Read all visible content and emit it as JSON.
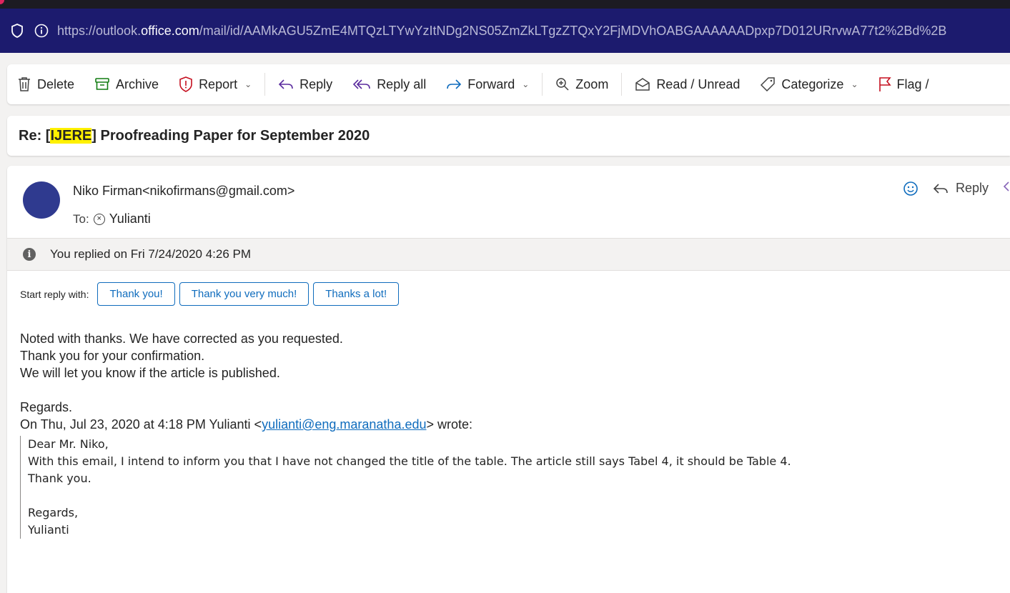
{
  "browser": {
    "url_prefix": "https://outlook.",
    "url_domain": "office.com",
    "url_path": "/mail/id/AAMkAGU5ZmE4MTQzLTYwYzItNDg2NS05ZmZkLTgzZTQxY2FjMDVhOABGAAAAAADpxp7D012URrvwA77t2%2Bd%2B"
  },
  "toolbar": {
    "delete": "Delete",
    "archive": "Archive",
    "report": "Report",
    "reply": "Reply",
    "reply_all": "Reply all",
    "forward": "Forward",
    "zoom": "Zoom",
    "read_unread": "Read / Unread",
    "categorize": "Categorize",
    "flag": "Flag /"
  },
  "subject": {
    "prefix": "Re: [",
    "highlight": "IJERE",
    "suffix": "] Proofreading Paper for September 2020"
  },
  "message": {
    "from": "Niko Firman<nikofirmans@gmail.com>",
    "to_label": "To:",
    "to_name": "Yulianti",
    "reply_label": "Reply",
    "info": "You replied on Fri 7/24/2020 4:26 PM",
    "quick_label": "Start reply with:",
    "quick_replies": [
      "Thank you!",
      "Thank you very much!",
      "Thanks a lot!"
    ],
    "body_lines": [
      "Noted with thanks. We have corrected as you requested.",
      "Thank you for your confirmation.",
      "We will let you know if the article is published."
    ],
    "regards": "Regards.",
    "orig_prefix": "On Thu, Jul 23, 2020 at 4:18 PM Yulianti <",
    "orig_email": "yulianti@eng.maranatha.edu",
    "orig_suffix": "> wrote:",
    "quote": {
      "greeting": "Dear Mr. Niko,",
      "line1": "With this email, I intend to inform you that I have not changed the title of the table. The article still says Tabel 4, it should be Table 4.",
      "line2": "Thank you.",
      "regards": "Regards,",
      "name": "Yulianti"
    }
  }
}
